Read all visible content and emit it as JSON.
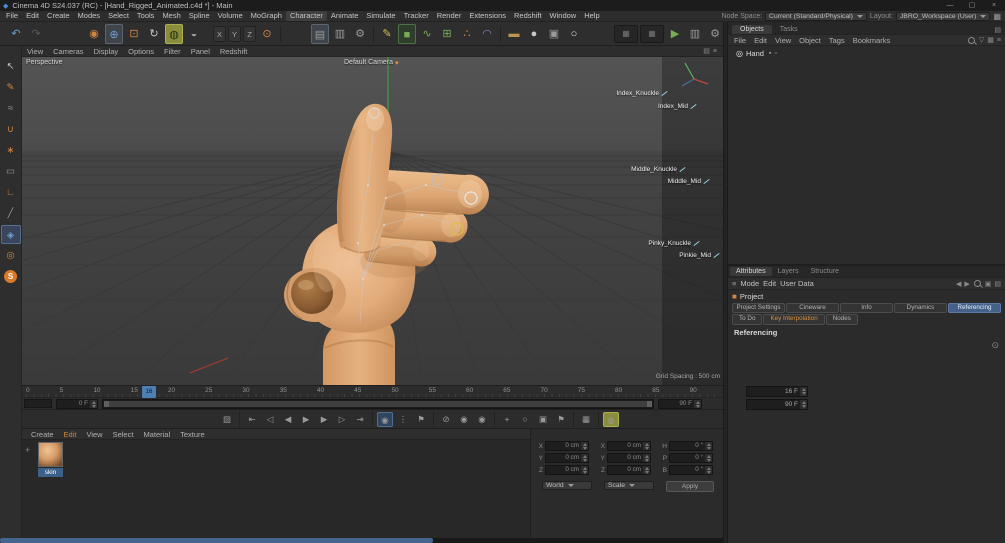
{
  "window": {
    "title": "Cinema 4D S24.037 (RC) - [Hand_Rigged_Animated.c4d *] - Main"
  },
  "icons": {
    "app": "◆",
    "min": "—",
    "max": "▢",
    "close": "×",
    "undo": "↶",
    "redo": "↷",
    "live_selection": "◉",
    "move": "⊕",
    "scale": "⊡",
    "rotate": "↻",
    "active_tool": "◍",
    "tweak": "◒",
    "axis_x": "X",
    "axis_y": "Y",
    "axis_z": "Z",
    "coord_sys": "⊙",
    "render_view": "▤",
    "render_pv": "▥",
    "render_settings": "⚙",
    "pen": "✎",
    "cube": "■",
    "spline": "∿",
    "mograph": "⊞",
    "simulate": "∴",
    "deformer": "◠",
    "floor": "▬",
    "sky": "●",
    "stage": "▣",
    "light": "○",
    "layout_a": "▦",
    "layout_b": "▦",
    "play_green": "▶",
    "render_team": "▥",
    "prefs": "⚙",
    "pal_arrow": "↖",
    "pal_brush": "✎",
    "pal_smooth": "≈",
    "pal_magnet": "∪",
    "pal_spike": "∗",
    "pal_flatten": "▭",
    "pal_ruler": "∟",
    "pal_knife": "╱",
    "pal_mirror": "◈",
    "pal_sphere": "◎",
    "pal_sculpt": "S",
    "cam_marker": "◆",
    "tl_mode": "▧",
    "goto_start": "⇤",
    "prev_key": "◁",
    "prev_frame": "◀",
    "play": "▶",
    "next_frame": "▶",
    "next_key": "▷",
    "goto_end": "⇥",
    "rec_key": "◉",
    "autokey_dots": "⋮",
    "marker": "⚑",
    "rec_off": "⊘",
    "rec_point": "◉",
    "rec_auto": "◉",
    "k_pos": "+",
    "k_rot": "○",
    "k_param": "▣",
    "k_pla": "⚑",
    "snap": "▦",
    "anim_tool": "◍",
    "mat_add": "+",
    "joint": "◎",
    "tag_a": "▪",
    "tag_b": "▫",
    "funnel": "▽",
    "grid_sm": "▦",
    "menu_sm": "≡",
    "panel_sm": "▤",
    "hamburger": "≡",
    "back": "◀",
    "fwd": "▶",
    "lock": "▣",
    "circle_btn": "⊙",
    "proj_cube": "■"
  },
  "menu_bar": {
    "items": [
      "File",
      "Edit",
      "Create",
      "Modes",
      "Select",
      "Tools",
      "Mesh",
      "Spline",
      "Volume",
      "MoGraph",
      "Character",
      "Animate",
      "Simulate",
      "Tracker",
      "Render",
      "Extensions",
      "Redshift",
      "Window",
      "Help"
    ],
    "node_space_label": "Node Space:",
    "node_space_value": "Current (Standard/Physical)",
    "layout_label": "Layout:",
    "layout_value": "JBRO_Workspace (User)"
  },
  "viewport": {
    "menu": [
      "View",
      "Cameras",
      "Display",
      "Options",
      "Filter",
      "Panel",
      "Redshift"
    ],
    "view_label": "Perspective",
    "camera_label": "Default Camera",
    "grid_spacing_label": "Grid Spacing : 500 cm",
    "rig_labels": [
      "Index_Knuckle",
      "Index_Mid",
      "Middle_Knuckle",
      "Middle_Mid",
      "Pinky_Knuckle",
      "Pinkie_Mid"
    ]
  },
  "timeline": {
    "ticks": [
      "0",
      "5",
      "10",
      "15",
      "20",
      "25",
      "30",
      "35",
      "40",
      "45",
      "50",
      "55",
      "60",
      "65",
      "70",
      "75",
      "80",
      "85",
      "90"
    ],
    "playhead": "16",
    "range_start": "0 F",
    "range_end": "90 F",
    "current_frame": "16 F",
    "last_frame": "90 F"
  },
  "materials": {
    "menu": [
      "Create",
      "Edit",
      "View",
      "Select",
      "Material",
      "Texture"
    ],
    "items": [
      {
        "name": "skin"
      }
    ]
  },
  "coordinates": {
    "pos_labels": [
      "X",
      "Y",
      "Z"
    ],
    "rot_labels": [
      "H",
      "P",
      "B"
    ],
    "pos_values": [
      "0 cm",
      "0 cm",
      "0 cm"
    ],
    "scale_values": [
      "0 cm",
      "0 cm",
      "0 cm"
    ],
    "rot_values": [
      "0 °",
      "0 °",
      "0 °"
    ],
    "system": "World",
    "mode": "Scale",
    "apply": "Apply"
  },
  "objects": {
    "tabs": [
      "Objects",
      "Tasks"
    ],
    "menu": [
      "File",
      "Edit",
      "View",
      "Object",
      "Tags",
      "Bookmarks"
    ],
    "items": [
      {
        "name": "Hand"
      }
    ]
  },
  "attributes": {
    "tabs": [
      "Attributes",
      "Layers",
      "Structure"
    ],
    "mode": "Mode",
    "edit": "Edit",
    "user_data": "User Data",
    "object_name": "Project",
    "tab_buttons": [
      "Project Settings",
      "Cineware",
      "Info",
      "Dynamics",
      "Referencing"
    ],
    "tab_buttons2": [
      "To Do",
      "Key Interpolation",
      "Nodes"
    ],
    "section_title": "Referencing"
  }
}
